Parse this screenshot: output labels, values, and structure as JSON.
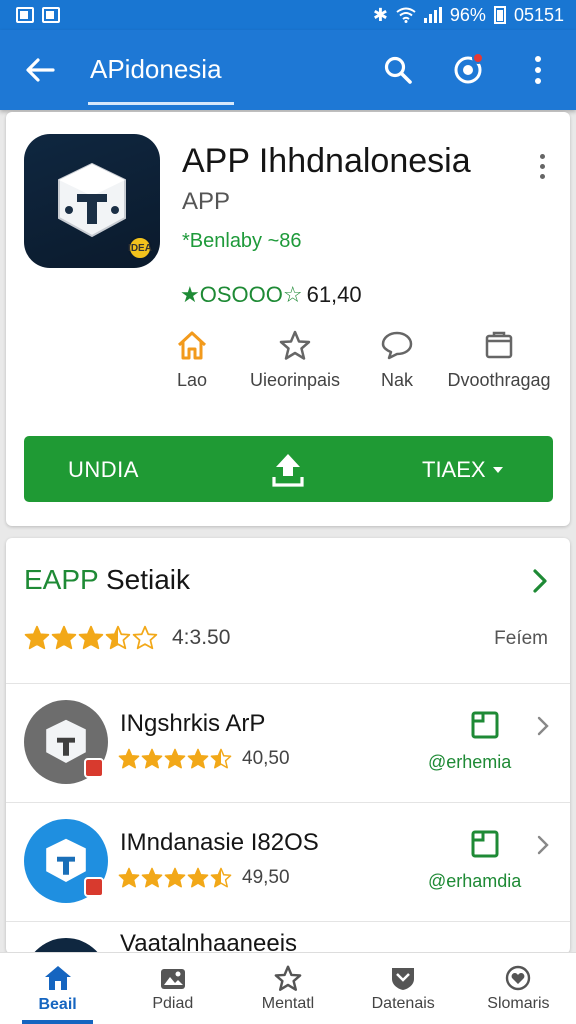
{
  "status_bar": {
    "time": "05151",
    "battery": "96%"
  },
  "app_bar": {
    "title": "APidonesia"
  },
  "app": {
    "name": "APP Ihhdnalonesia",
    "type": "APP",
    "tag": "*Benlaby ~86",
    "rating_stars": "★OSOOO☆",
    "rating_count": "61,40",
    "icon_badge": "IDEA"
  },
  "actions": [
    {
      "label": "Lao",
      "icon": "home-icon"
    },
    {
      "label": "Uieorinpais",
      "icon": "star-outline-icon"
    },
    {
      "label": "Nak",
      "icon": "chat-bubble-icon"
    },
    {
      "label": "Dvoothragag",
      "icon": "clipboard-icon"
    }
  ],
  "install": {
    "left_label": "UNDIA",
    "right_label": "TIAEX"
  },
  "similar": {
    "title_prefix": "EAPP",
    "title_rest": " Setiaik",
    "score": "4:3.50",
    "rating": 3.5,
    "link": "Feíem"
  },
  "list": [
    {
      "title": "INgshrkis ArP",
      "rating": 4.5,
      "score": "40,50",
      "developer": "@erhemia",
      "icon_bg": "#6d6d6d"
    },
    {
      "title": "IMndanasie I82OS",
      "rating": 4.5,
      "score": "49,50",
      "developer": "@erhamdia",
      "icon_bg": "#1f8fe0"
    }
  ],
  "partial_item": {
    "title": "Vaatalnhaaneeis"
  },
  "bottom_nav": [
    {
      "label": "Beail",
      "icon": "home-icon",
      "active": true
    },
    {
      "label": "Pdiad",
      "icon": "image-icon",
      "active": false
    },
    {
      "label": "Mentatl",
      "icon": "star-icon",
      "active": false
    },
    {
      "label": "Datenais",
      "icon": "shield-icon",
      "active": false
    },
    {
      "label": "Slomaris",
      "icon": "heart-icon",
      "active": false
    }
  ],
  "colors": {
    "primary": "#1e78d5",
    "install_green": "#1f9a34",
    "star": "#f2a818",
    "rating_green": "#1e8a35"
  }
}
